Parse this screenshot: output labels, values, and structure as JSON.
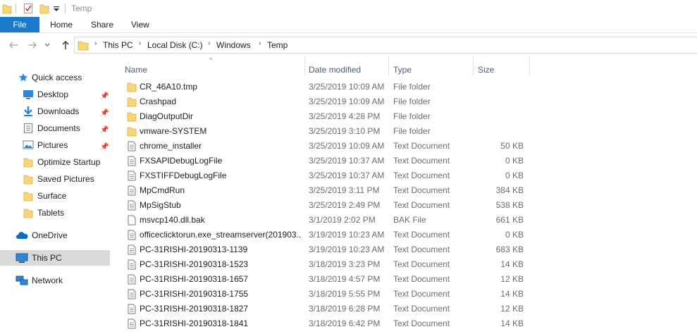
{
  "window": {
    "title": "Temp"
  },
  "ribbon": {
    "tabs": [
      "File",
      "Home",
      "Share",
      "View"
    ]
  },
  "address": {
    "crumbs": [
      "This PC",
      "Local Disk (C:)",
      "Windows",
      "Temp"
    ]
  },
  "nav": {
    "quick_access": "Quick access",
    "items": [
      {
        "label": "Desktop",
        "icon": "desktop-icon",
        "pinned": true
      },
      {
        "label": "Downloads",
        "icon": "downloads-icon",
        "pinned": true
      },
      {
        "label": "Documents",
        "icon": "documents-icon",
        "pinned": true
      },
      {
        "label": "Pictures",
        "icon": "pictures-icon",
        "pinned": true
      },
      {
        "label": "Optimize Startup",
        "icon": "folder-icon",
        "pinned": false
      },
      {
        "label": "Saved Pictures",
        "icon": "folder-icon",
        "pinned": false
      },
      {
        "label": "Surface",
        "icon": "folder-icon",
        "pinned": false
      },
      {
        "label": "Tablets",
        "icon": "folder-icon",
        "pinned": false
      }
    ],
    "onedrive": "OneDrive",
    "thispc": "This PC",
    "network": "Network"
  },
  "columns": {
    "name": "Name",
    "date": "Date modified",
    "type": "Type",
    "size": "Size"
  },
  "files": [
    {
      "name": "CR_46A10.tmp",
      "date": "3/25/2019 10:09 AM",
      "type": "File folder",
      "size": "",
      "kind": "folder"
    },
    {
      "name": "Crashpad",
      "date": "3/25/2019 10:09 AM",
      "type": "File folder",
      "size": "",
      "kind": "folder"
    },
    {
      "name": "DiagOutputDir",
      "date": "3/25/2019 4:28 PM",
      "type": "File folder",
      "size": "",
      "kind": "folder"
    },
    {
      "name": "vmware-SYSTEM",
      "date": "3/25/2019 3:10 PM",
      "type": "File folder",
      "size": "",
      "kind": "folder"
    },
    {
      "name": "chrome_installer",
      "date": "3/25/2019 10:09 AM",
      "type": "Text Document",
      "size": "50 KB",
      "kind": "doc"
    },
    {
      "name": "FXSAPIDebugLogFile",
      "date": "3/25/2019 10:37 AM",
      "type": "Text Document",
      "size": "0 KB",
      "kind": "doc"
    },
    {
      "name": "FXSTIFFDebugLogFile",
      "date": "3/25/2019 10:37 AM",
      "type": "Text Document",
      "size": "0 KB",
      "kind": "doc"
    },
    {
      "name": "MpCmdRun",
      "date": "3/25/2019 3:11 PM",
      "type": "Text Document",
      "size": "384 KB",
      "kind": "doc"
    },
    {
      "name": "MpSigStub",
      "date": "3/25/2019 2:49 PM",
      "type": "Text Document",
      "size": "538 KB",
      "kind": "doc"
    },
    {
      "name": "msvcp140.dll.bak",
      "date": "3/1/2019 2:02 PM",
      "type": "BAK File",
      "size": "661 KB",
      "kind": "blank"
    },
    {
      "name": "officeclicktorun.exe_streamserver(201903...",
      "date": "3/19/2019 10:23 AM",
      "type": "Text Document",
      "size": "0 KB",
      "kind": "doc"
    },
    {
      "name": "PC-31RISHI-20190313-1139",
      "date": "3/19/2019 10:23 AM",
      "type": "Text Document",
      "size": "683 KB",
      "kind": "doc"
    },
    {
      "name": "PC-31RISHI-20190318-1523",
      "date": "3/18/2019 3:23 PM",
      "type": "Text Document",
      "size": "14 KB",
      "kind": "doc"
    },
    {
      "name": "PC-31RISHI-20190318-1657",
      "date": "3/18/2019 4:57 PM",
      "type": "Text Document",
      "size": "12 KB",
      "kind": "doc"
    },
    {
      "name": "PC-31RISHI-20190318-1755",
      "date": "3/18/2019 5:55 PM",
      "type": "Text Document",
      "size": "14 KB",
      "kind": "doc"
    },
    {
      "name": "PC-31RISHI-20190318-1827",
      "date": "3/18/2019 6:28 PM",
      "type": "Text Document",
      "size": "12 KB",
      "kind": "doc"
    },
    {
      "name": "PC-31RISHI-20190318-1841",
      "date": "3/18/2019 6:42 PM",
      "type": "Text Document",
      "size": "14 KB",
      "kind": "doc"
    }
  ],
  "colors": {
    "file_tab": "#1979ca",
    "folder": "#f8d775",
    "selected_nav": "#d9d9d9",
    "header_text": "#4c607a"
  }
}
